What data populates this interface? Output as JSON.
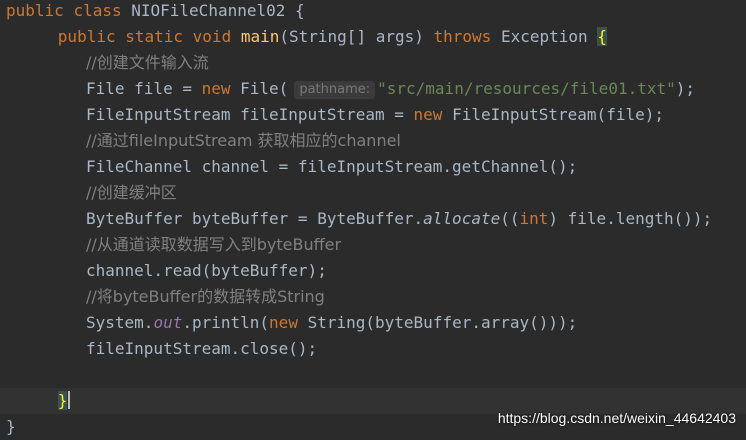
{
  "editor": {
    "colors": {
      "background": "#2b2b2b",
      "keyword": "#cc7832",
      "method_declaration": "#ffc66d",
      "string": "#6a8759",
      "comment": "#808080",
      "static_field": "#9876aa",
      "plain": "#a9b7c6",
      "current_line": "#323232"
    },
    "lines": [
      {
        "class_open": {
          "kw1": "public",
          "kw2": "class",
          "name": "NIOFileChannel02",
          "brace": "{"
        }
      },
      {
        "method_decl": {
          "kw1": "public",
          "kw2": "static",
          "kw3": "void",
          "name": "main",
          "params": "(String[] args)",
          "throws": "throws",
          "exc": "Exception",
          "brace": "{"
        }
      },
      {
        "comment": "//创建文件输入流"
      },
      {
        "file_decl": {
          "lhs": "File file = ",
          "kw": "new",
          "call": "File(",
          "hint": "pathname:",
          "string": "\"src/main/resources/file01.txt\"",
          "close": ");"
        }
      },
      {
        "fis_decl": {
          "lhs": "FileInputStream fileInputStream = ",
          "kw": "new",
          "call": "FileInputStream(file);"
        }
      },
      {
        "comment": "//通过fileInputStream 获取相应的channel"
      },
      {
        "channel_decl": {
          "text": "FileChannel channel = fileInputStream.getChannel();"
        }
      },
      {
        "comment": "//创建缓冲区"
      },
      {
        "buffer_decl": {
          "lhs": "ByteBuffer byteBuffer = ByteBuffer.",
          "method": "allocate",
          "open": "((",
          "kw": "int",
          "rest": ") file.length());"
        }
      },
      {
        "comment": "//从通道读取数据写入到byteBuffer"
      },
      {
        "read_call": {
          "text": "channel.read(byteBuffer);"
        }
      },
      {
        "comment": "//将byteBuffer的数据转成String"
      },
      {
        "println": {
          "obj": "System.",
          "field": "out",
          "call": ".println(",
          "kw": "new",
          "rest": " String(byteBuffer.array()));"
        }
      },
      {
        "close_call": {
          "text": "fileInputStream.close();"
        }
      },
      {
        "blank": ""
      },
      {
        "method_close": "}"
      },
      {
        "class_close": "}"
      }
    ]
  },
  "watermark": "https://blog.csdn.net/weixin_44642403"
}
